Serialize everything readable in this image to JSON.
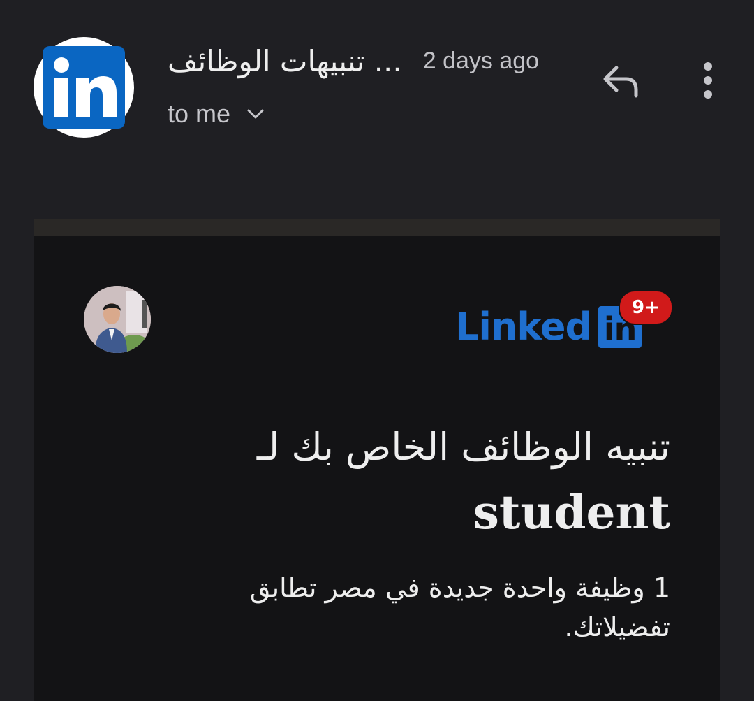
{
  "header": {
    "sender_name": "تنبيهات الوظائف ...",
    "timestamp": "2 days ago",
    "recipient_label": "to me",
    "avatar_icon": "linkedin-logo-icon",
    "reply_icon": "reply-icon",
    "more_icon": "more-vert-icon",
    "chevron_icon": "chevron-down-icon"
  },
  "email": {
    "brand_word": "Linked",
    "brand_box": "in",
    "notification_badge": "9+",
    "heading": "تنبيه الوظائف الخاص بك لـ",
    "keyword": "student",
    "summary": "1 وظيفة واحدة جديدة في مصر تطابق تفضيلاتك."
  },
  "colors": {
    "background": "#1f1f23",
    "card": "#131315",
    "linkedin_blue": "#1f6fcf",
    "badge_red": "#d11a1a"
  }
}
